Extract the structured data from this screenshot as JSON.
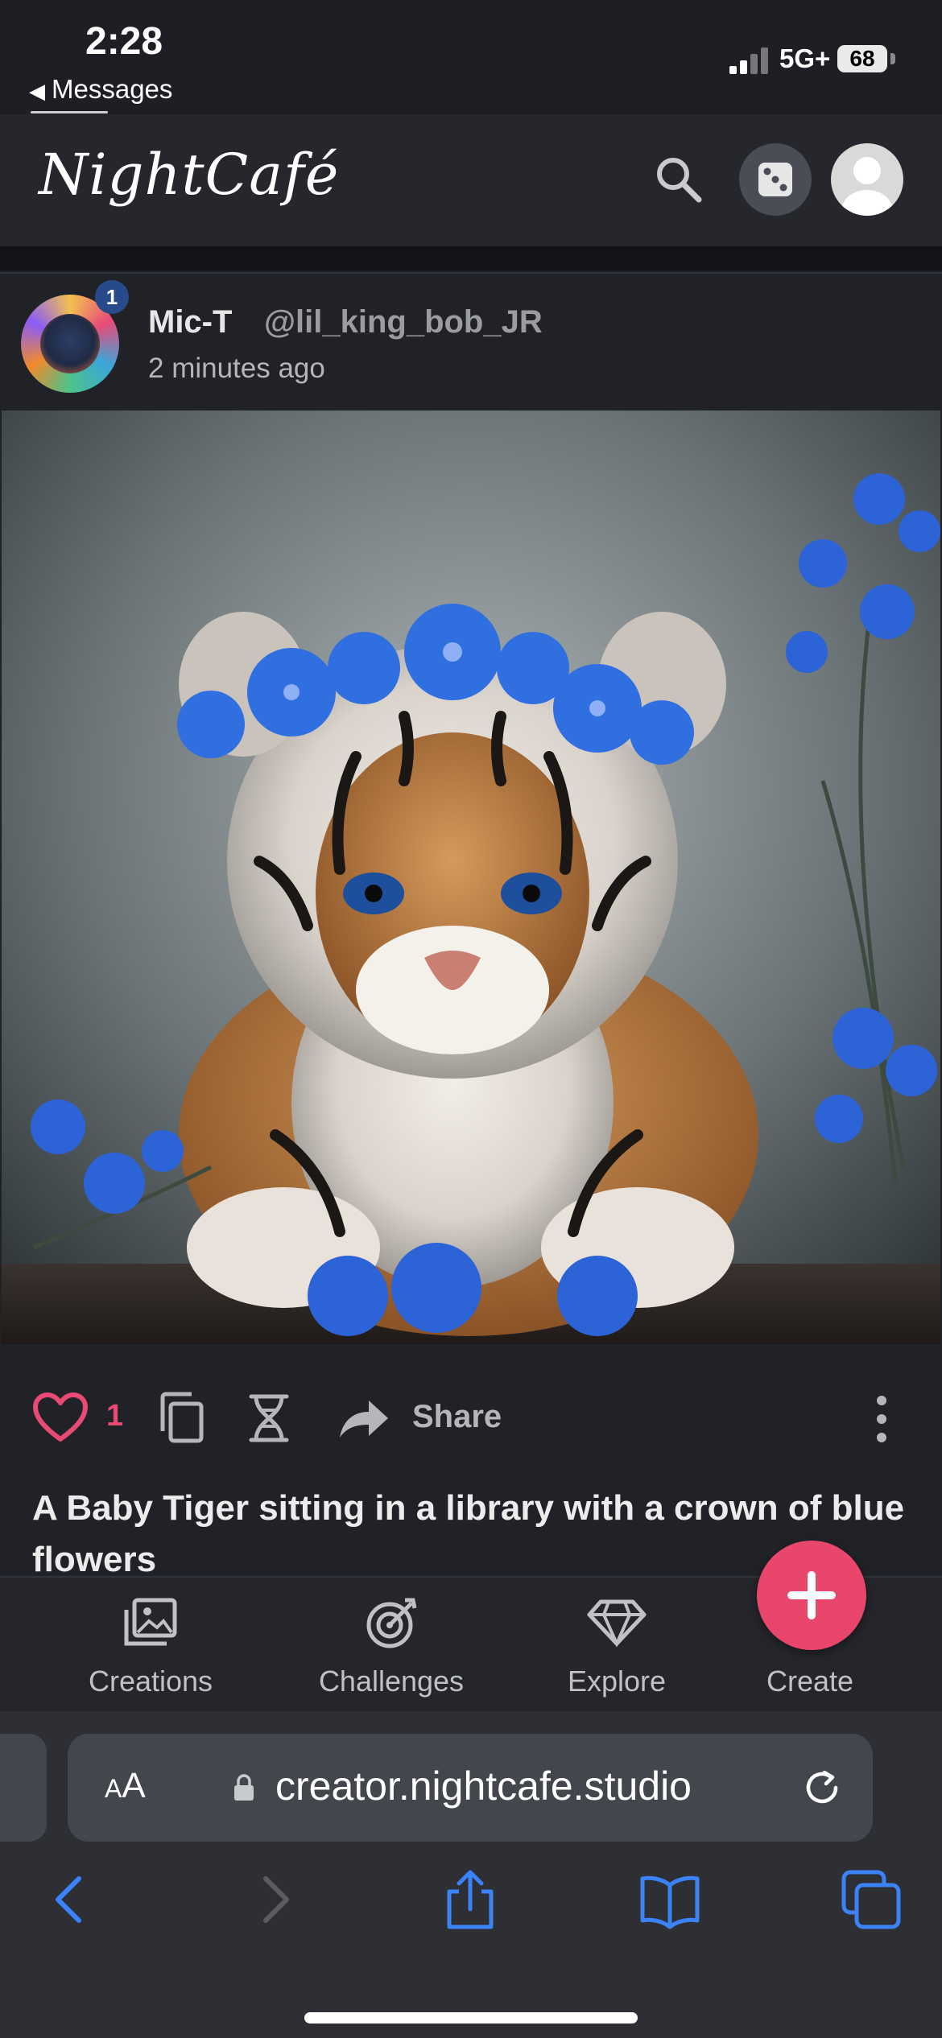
{
  "status_bar": {
    "time": "2:28",
    "back_label": "Messages",
    "network": "5G+",
    "battery": "68"
  },
  "app_header": {
    "logo_text": "NightCafé",
    "accent_color": "#e9466c"
  },
  "post": {
    "display_name": "Mic-T",
    "handle": "@lil_king_bob_JR",
    "posted_time": "2 minutes ago",
    "avatar_badge": "1",
    "image_subject": "baby tiger with crown of blue flowers",
    "like_count": "1",
    "share_label": "Share",
    "prompt": "A Baby Tiger sitting in a library with a crown of blue flowers"
  },
  "tab_bar": {
    "tabs": [
      {
        "label": "Creations",
        "icon": "image-icon"
      },
      {
        "label": "Challenges",
        "icon": "target-icon"
      },
      {
        "label": "Explore",
        "icon": "diamond-icon"
      },
      {
        "label": "Create",
        "icon": "plus-icon"
      }
    ]
  },
  "browser": {
    "text_size_label": "AA",
    "url": "creator.nightcafe.studio",
    "link_color": "#3b82f6"
  }
}
